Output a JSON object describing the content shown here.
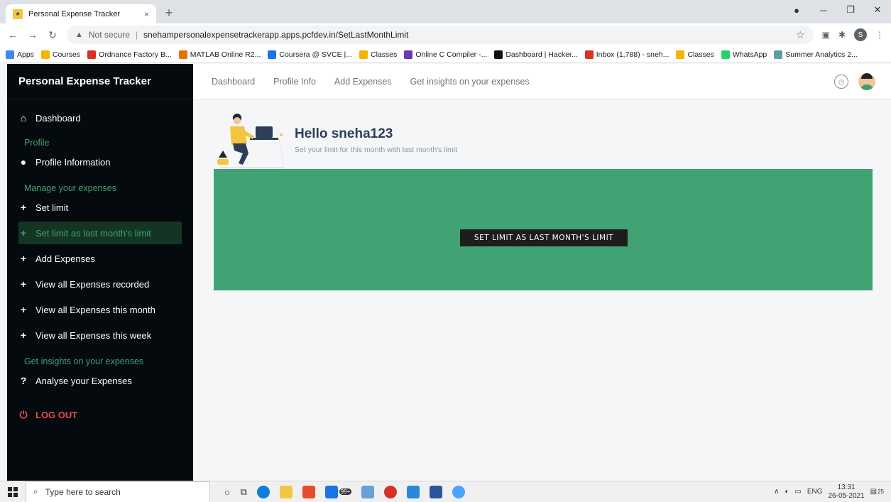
{
  "browser": {
    "tab_title": "Personal Expense Tracker",
    "tab_close": "×",
    "new_tab": "+",
    "url_prefix": "Not secure",
    "url": "snehampersonalexpensetrackerapp.apps.pcfdev.in/SetLastMonthLimit",
    "profile_initial": "S",
    "bookmarks": [
      {
        "label": "Apps",
        "color": "#4285f4"
      },
      {
        "label": "Courses",
        "color": "#f4b400"
      },
      {
        "label": "Ordnance Factory B...",
        "color": "#d93025"
      },
      {
        "label": "MATLAB Online R2...",
        "color": "#e37400"
      },
      {
        "label": "Coursera @ SVCE |...",
        "color": "#1a73e8"
      },
      {
        "label": "Classes",
        "color": "#f4b400"
      },
      {
        "label": "Online C Compiler -...",
        "color": "#673ab7"
      },
      {
        "label": "Dashboard | Hacker...",
        "color": "#111111"
      },
      {
        "label": "Inbox (1,788) - sneh...",
        "color": "#d93025"
      },
      {
        "label": "Classes",
        "color": "#f4b400"
      },
      {
        "label": "WhatsApp",
        "color": "#25d366"
      },
      {
        "label": "Summer Analytics 2...",
        "color": "#5f9ea0"
      }
    ]
  },
  "sidebar": {
    "brand": "Personal Expense Tracker",
    "dashboard": "Dashboard",
    "section_profile": "Profile",
    "profile_info": "Profile Information",
    "section_manage": "Manage your expenses",
    "set_limit": "Set limit",
    "set_limit_last": "Set limit as last month's limit",
    "add_expenses": "Add Expenses",
    "view_all": "View all Expenses recorded",
    "view_month": "View all Expenses this month",
    "view_week": "View all Expenses this week",
    "section_insights": "Get insights on your expenses",
    "analyse": "Analyse your Expenses",
    "logout": "LOG OUT"
  },
  "topnav": {
    "dashboard": "Dashboard",
    "profile": "Profile Info",
    "add": "Add Expenses",
    "insights": "Get insights on your expenses"
  },
  "main": {
    "greeting": "Hello sneha123",
    "subtitle": "Set your limit for this month with last month's limit",
    "action_button": "SET LIMIT AS LAST MONTH'S LIMIT"
  },
  "taskbar": {
    "search_placeholder": "Type here to search",
    "badge": "99+",
    "lang": "ENG",
    "time": "13:31",
    "date": "26-05-2021",
    "notif_count": "25"
  },
  "colors": {
    "accent": "#41a374",
    "sidebar_bg": "#050a0e",
    "logout": "#e84b4b"
  }
}
